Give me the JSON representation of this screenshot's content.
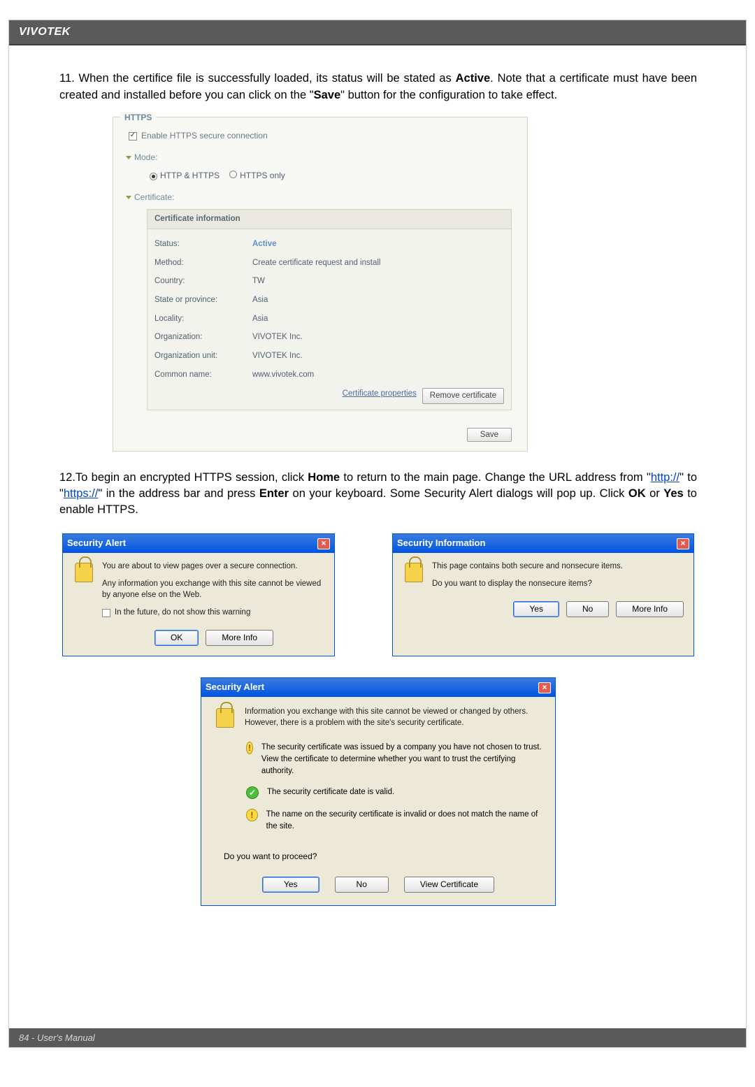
{
  "header": {
    "brand": "VIVOTEK"
  },
  "step11": {
    "pre": "11. When the certifice file is successfully loaded, its status will be stated as ",
    "active_word": "Active",
    "mid": ". Note that a certificate must have been created and installed before you can click on the \"",
    "save_word": "Save",
    "post": "\" button for the configuration to take effect."
  },
  "https_panel": {
    "legend": "HTTPS",
    "enable_label": "Enable HTTPS secure connection",
    "mode_label": "Mode:",
    "mode_opts": {
      "a": "HTTP & HTTPS",
      "b": "HTTPS only"
    },
    "cert_label": "Certificate:",
    "cert_head": "Certificate information",
    "rows": {
      "status_k": "Status:",
      "status_v": "Active",
      "method_k": "Method:",
      "method_v": "Create certificate request and install",
      "country_k": "Country:",
      "country_v": "TW",
      "state_k": "State or province:",
      "state_v": "Asia",
      "locality_k": "Locality:",
      "locality_v": "Asia",
      "org_k": "Organization:",
      "org_v": "VIVOTEK Inc.",
      "orgu_k": "Organization unit:",
      "orgu_v": "VIVOTEK Inc.",
      "cn_k": "Common name:",
      "cn_v": "www.vivotek.com"
    },
    "cert_props": "Certificate properties",
    "remove": "Remove certificate",
    "save": "Save"
  },
  "step12": {
    "pre": "12.To begin an encrypted HTTPS session, click ",
    "home": "Home",
    "mid1": " to return to the main page. Change the URL address from \"",
    "http": "http://",
    "mid2": "\" to \"",
    "https": "https://",
    "mid3": "\" in the address bar and press ",
    "enter": "Enter",
    "mid4": " on your keyboard. Some Security Alert dialogs will pop up. Click ",
    "ok": "OK",
    "or": " or ",
    "yes": "Yes",
    "post": " to enable HTTPS."
  },
  "dlg_a": {
    "title": "Security Alert",
    "line1": "You are about to view pages over a secure connection.",
    "line2": "Any information you exchange with this site cannot be viewed by anyone else on the Web.",
    "checkbox": "In the future, do not show this warning",
    "ok": "OK",
    "more": "More Info"
  },
  "dlg_b": {
    "title": "Security Information",
    "line1": "This page contains both secure and nonsecure items.",
    "line2": "Do you want to display the nonsecure items?",
    "yes": "Yes",
    "no": "No",
    "more": "More Info"
  },
  "dlg_c": {
    "title": "Security Alert",
    "intro": "Information you exchange with this site cannot be viewed or changed by others. However, there is a problem with the site's security certificate.",
    "w1": "The security certificate was issued by a company you have not chosen to trust. View the certificate to determine whether you want to trust the certifying authority.",
    "ok1": "The security certificate date is valid.",
    "w2": "The name on the security certificate is invalid or does not match the name of the site.",
    "proceed": "Do you want to proceed?",
    "yes": "Yes",
    "no": "No",
    "view": "View Certificate"
  },
  "footer": {
    "text": "84 - User's Manual"
  }
}
